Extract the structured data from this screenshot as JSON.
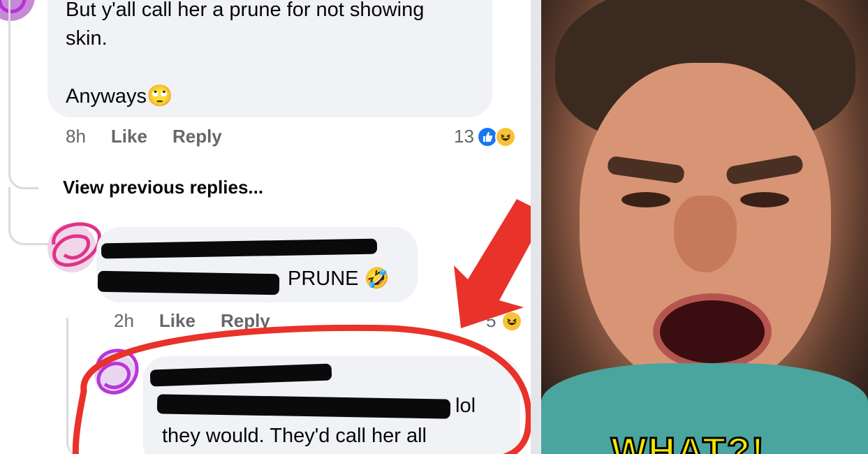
{
  "comment1": {
    "text_line1": "But y'all call her a prune for not showing",
    "text_line2": "skin.",
    "text_line3": "Anyways",
    "emoji": "🙄",
    "time": "8h",
    "like": "Like",
    "reply": "Reply",
    "reaction_count": "13"
  },
  "view_previous": "View previous replies...",
  "comment2": {
    "text_end": "PRUNE",
    "emoji": "🤣",
    "time": "2h",
    "like": "Like",
    "reply": "Reply",
    "reaction_count": "5"
  },
  "comment3": {
    "text_end": "lol",
    "text_line2": "they would. They'd call her all"
  },
  "meme": {
    "caption": "WHAT?!"
  },
  "colors": {
    "annotation_red": "#e8322a",
    "bubble": "#f0f2f5",
    "like_blue": "#1877f2"
  }
}
